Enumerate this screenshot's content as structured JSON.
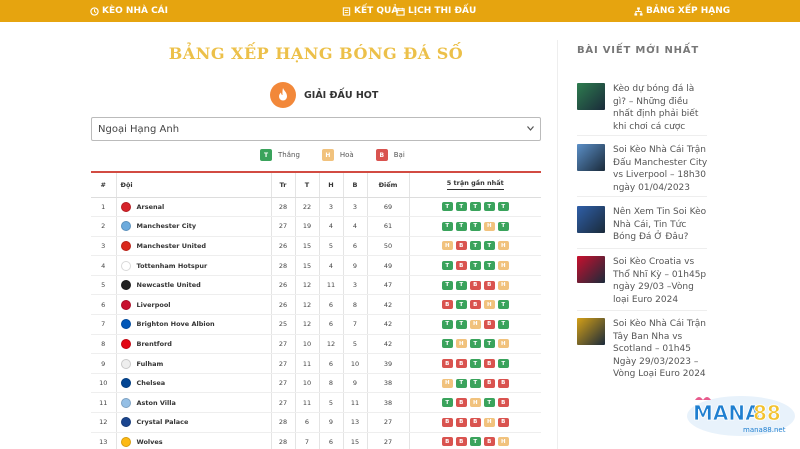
{
  "nav": {
    "item1": "KÈO NHÀ CÁI",
    "item2": "KẾT QUẢ",
    "item3": "LỊCH THI ĐẤU",
    "item4": "BẢNG XẾP HẠNG"
  },
  "page": {
    "title": "BẢNG XẾP HẠNG BÓNG ĐÁ SỐ",
    "hot_label": "GIẢI ĐẤU HOT",
    "league_selected": "Ngoại Hạng Anh"
  },
  "legend": {
    "win": "Thắng",
    "draw": "Hoà",
    "loss": "Bại",
    "win_code": "T",
    "draw_code": "H",
    "loss_code": "B"
  },
  "table": {
    "headers": {
      "rank": "#",
      "team": "Đội",
      "played": "Tr",
      "won": "T",
      "drawn": "H",
      "lost": "B",
      "points": "Điểm",
      "form": "5 trận gần nhất"
    },
    "rows": [
      {
        "rank": "1",
        "team": "Arsenal",
        "p": "28",
        "w": "22",
        "d": "3",
        "l": "3",
        "pts": "69",
        "form": [
          "T",
          "T",
          "T",
          "T",
          "T"
        ],
        "crest": "#d6232a"
      },
      {
        "rank": "2",
        "team": "Manchester City",
        "p": "27",
        "w": "19",
        "d": "4",
        "l": "4",
        "pts": "61",
        "form": [
          "T",
          "T",
          "T",
          "H",
          "T"
        ],
        "crest": "#6cabdd"
      },
      {
        "rank": "3",
        "team": "Manchester United",
        "p": "26",
        "w": "15",
        "d": "5",
        "l": "6",
        "pts": "50",
        "form": [
          "H",
          "B",
          "T",
          "T",
          "H"
        ],
        "crest": "#da291c"
      },
      {
        "rank": "4",
        "team": "Tottenham Hotspur",
        "p": "28",
        "w": "15",
        "d": "4",
        "l": "9",
        "pts": "49",
        "form": [
          "T",
          "B",
          "T",
          "T",
          "H"
        ],
        "crest": "#ffffff"
      },
      {
        "rank": "5",
        "team": "Newcastle United",
        "p": "26",
        "w": "12",
        "d": "11",
        "l": "3",
        "pts": "47",
        "form": [
          "T",
          "T",
          "B",
          "B",
          "H"
        ],
        "crest": "#222222"
      },
      {
        "rank": "6",
        "team": "Liverpool",
        "p": "26",
        "w": "12",
        "d": "6",
        "l": "8",
        "pts": "42",
        "form": [
          "B",
          "T",
          "B",
          "H",
          "T"
        ],
        "crest": "#c8102e"
      },
      {
        "rank": "7",
        "team": "Brighton Hove Albion",
        "p": "25",
        "w": "12",
        "d": "6",
        "l": "7",
        "pts": "42",
        "form": [
          "T",
          "T",
          "H",
          "B",
          "T"
        ],
        "crest": "#0057b8"
      },
      {
        "rank": "8",
        "team": "Brentford",
        "p": "27",
        "w": "10",
        "d": "12",
        "l": "5",
        "pts": "42",
        "form": [
          "T",
          "H",
          "T",
          "T",
          "H"
        ],
        "crest": "#e30613"
      },
      {
        "rank": "9",
        "team": "Fulham",
        "p": "27",
        "w": "11",
        "d": "6",
        "l": "10",
        "pts": "39",
        "form": [
          "B",
          "B",
          "T",
          "B",
          "T"
        ],
        "crest": "#eeeeee"
      },
      {
        "rank": "10",
        "team": "Chelsea",
        "p": "27",
        "w": "10",
        "d": "8",
        "l": "9",
        "pts": "38",
        "form": [
          "H",
          "T",
          "T",
          "B",
          "B"
        ],
        "crest": "#034694"
      },
      {
        "rank": "11",
        "team": "Aston Villa",
        "p": "27",
        "w": "11",
        "d": "5",
        "l": "11",
        "pts": "38",
        "form": [
          "T",
          "B",
          "H",
          "T",
          "B"
        ],
        "crest": "#95bfe5"
      },
      {
        "rank": "12",
        "team": "Crystal Palace",
        "p": "28",
        "w": "6",
        "d": "9",
        "l": "13",
        "pts": "27",
        "form": [
          "B",
          "B",
          "B",
          "H",
          "B"
        ],
        "crest": "#1b458f"
      },
      {
        "rank": "13",
        "team": "Wolves",
        "p": "28",
        "w": "7",
        "d": "6",
        "l": "15",
        "pts": "27",
        "form": [
          "B",
          "B",
          "T",
          "B",
          "H"
        ],
        "crest": "#fdb913"
      }
    ]
  },
  "sidebar": {
    "title": "BÀI VIẾT MỚI NHẤT",
    "posts": [
      {
        "text": "Kèo dự bóng đá là gì? – Những điều nhất định phải biết khi chơi cá cược",
        "thumb": "#2e7d4f"
      },
      {
        "text": "Soi Kèo Nhà Cái Trận Đấu Manchester City vs Liverpool – 18h30 ngày 01/04/2023",
        "thumb": "#5b8fc7"
      },
      {
        "text": "Nên Xem Tin Soi Kèo Nhà Cái, Tin Tức Bóng Đá Ở Đâu?",
        "thumb": "#2f5fa8"
      },
      {
        "text": "Soi Kèo Croatia vs Thổ Nhĩ Kỳ – 01h45p ngày 29/03 –Vòng loại Euro 2024",
        "thumb": "#c8102e"
      },
      {
        "text": "Soi Kèo Nhà Cái Trận Tây Ban Nha vs Scotland – 01h45 Ngày 29/03/2023 – Vòng Loại Euro 2024",
        "thumb": "#d4a017"
      }
    ]
  },
  "logo": {
    "text": "MANA88",
    "sub": "mana88.net",
    "colors": {
      "primary": "#1f7fd0",
      "accent": "#f2c230"
    }
  },
  "colors": {
    "nav": "#e6a40f",
    "title": "#ecc049",
    "win": "#3aa35c",
    "draw": "#f1c27d",
    "loss": "#d9534f",
    "table_rule": "#d24b42"
  }
}
